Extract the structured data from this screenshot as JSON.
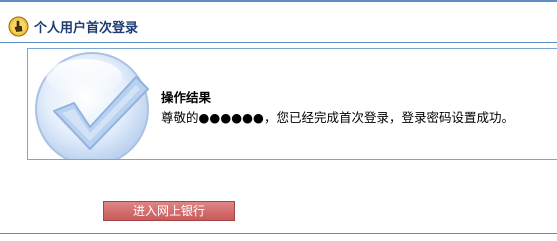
{
  "header": {
    "title": "个人用户首次登录",
    "icon": "hand-pointer-icon",
    "title_color": "#1c3c72"
  },
  "result": {
    "title": "操作结果",
    "message": "尊敬的●●●●●●，您已经完成首次登录，登录密码设置成功。",
    "icon": "checkmark-icon"
  },
  "actions": {
    "enter_label": "进入网上银行",
    "enter_color": "#d46c6c"
  },
  "colors": {
    "rule": "#5b8fc4",
    "box_border": "#7fa5cf"
  }
}
